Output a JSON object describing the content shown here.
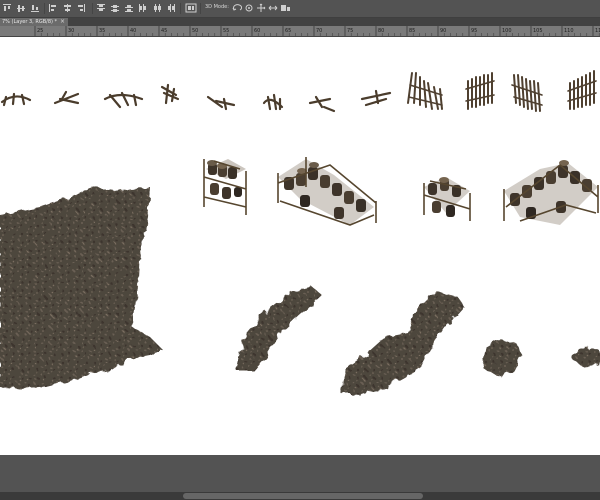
{
  "app": {
    "accent": "#535353",
    "canvas_bg": "#ffffff",
    "ruler_bg": "#7a7a7a"
  },
  "options_bar": {
    "mode_3d_label": "3D Mode:",
    "icons": [
      "align-top-edges-icon",
      "align-vertical-centers-icon",
      "align-bottom-edges-icon",
      "align-left-edges-icon",
      "align-horizontal-centers-icon",
      "align-right-edges-icon",
      "distribute-top-icon",
      "distribute-vertical-centers-icon",
      "distribute-bottom-icon",
      "distribute-left-icon",
      "distribute-horizontal-centers-icon",
      "distribute-right-icon",
      "auto-align-layers-icon",
      "3d-rotate-icon",
      "3d-roll-icon",
      "3d-pan-icon",
      "3d-slide-icon",
      "3d-scale-icon"
    ]
  },
  "document_tab": {
    "title": "7% (Layer 3, RGB/8) *",
    "close_glyph": "×"
  },
  "ruler": {
    "ticks": [
      "25",
      "30",
      "35",
      "40",
      "45",
      "50",
      "55",
      "60",
      "65",
      "70",
      "75",
      "80",
      "85",
      "90",
      "95",
      "100",
      "105",
      "110",
      "115",
      "120"
    ]
  },
  "canvas": {
    "assets": {
      "broken_fence_pieces": 8,
      "standing_fence_panels": 4,
      "barrel_crate_stacks": 4,
      "dirt_patches": 5
    }
  }
}
